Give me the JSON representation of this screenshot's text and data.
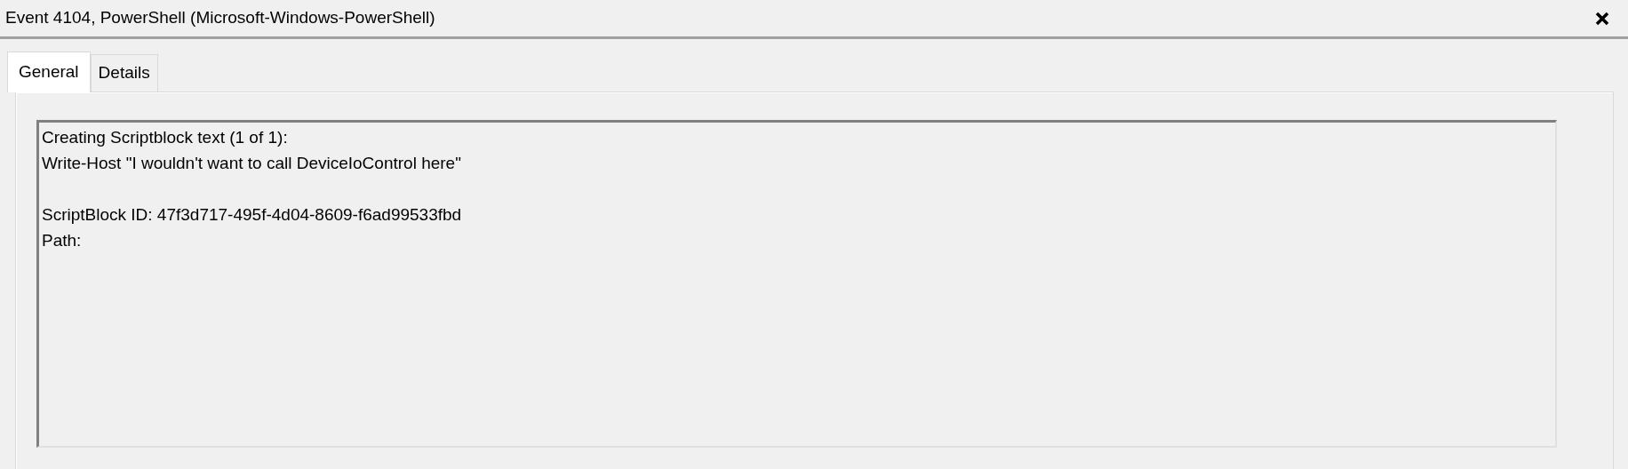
{
  "window": {
    "title": "Event 4104, PowerShell (Microsoft-Windows-PowerShell)"
  },
  "tabs": [
    {
      "label": "General",
      "selected": true
    },
    {
      "label": "Details",
      "selected": false
    }
  ],
  "event_text": {
    "paragraphs": [
      [
        "Creating Scriptblock text (1 of 1):",
        "Write-Host \"I wouldn't want to call DeviceIoControl here\""
      ],
      [
        "ScriptBlock ID: 47f3d717-495f-4d04-8609-f6ad99533fbd",
        "Path:"
      ]
    ]
  }
}
